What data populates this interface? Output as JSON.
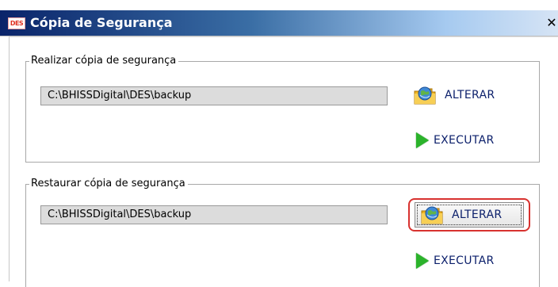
{
  "window": {
    "title": "Cópia de Segurança",
    "icon_text": "DES",
    "close_label": "✕"
  },
  "backup": {
    "legend": "Realizar cópia de segurança",
    "path": "C:\\BHISSDigital\\DES\\backup",
    "alterar_label": "ALTERAR",
    "executar_label": "EXECUTAR"
  },
  "restore": {
    "legend": "Restaurar cópia de segurança",
    "path": "C:\\BHISSDigital\\DES\\backup",
    "alterar_label": "ALTERAR",
    "executar_label": "EXECUTAR"
  },
  "colors": {
    "title_bar_start": "#0a246a",
    "title_bar_end": "#d6e4f5",
    "highlight_ring": "#d8322f",
    "execute_green": "#2bb32b",
    "button_text": "#0a1e6a"
  },
  "icons": {
    "alterar": "folder-globe-icon",
    "executar": "play-arrow-icon",
    "close": "close-icon"
  }
}
